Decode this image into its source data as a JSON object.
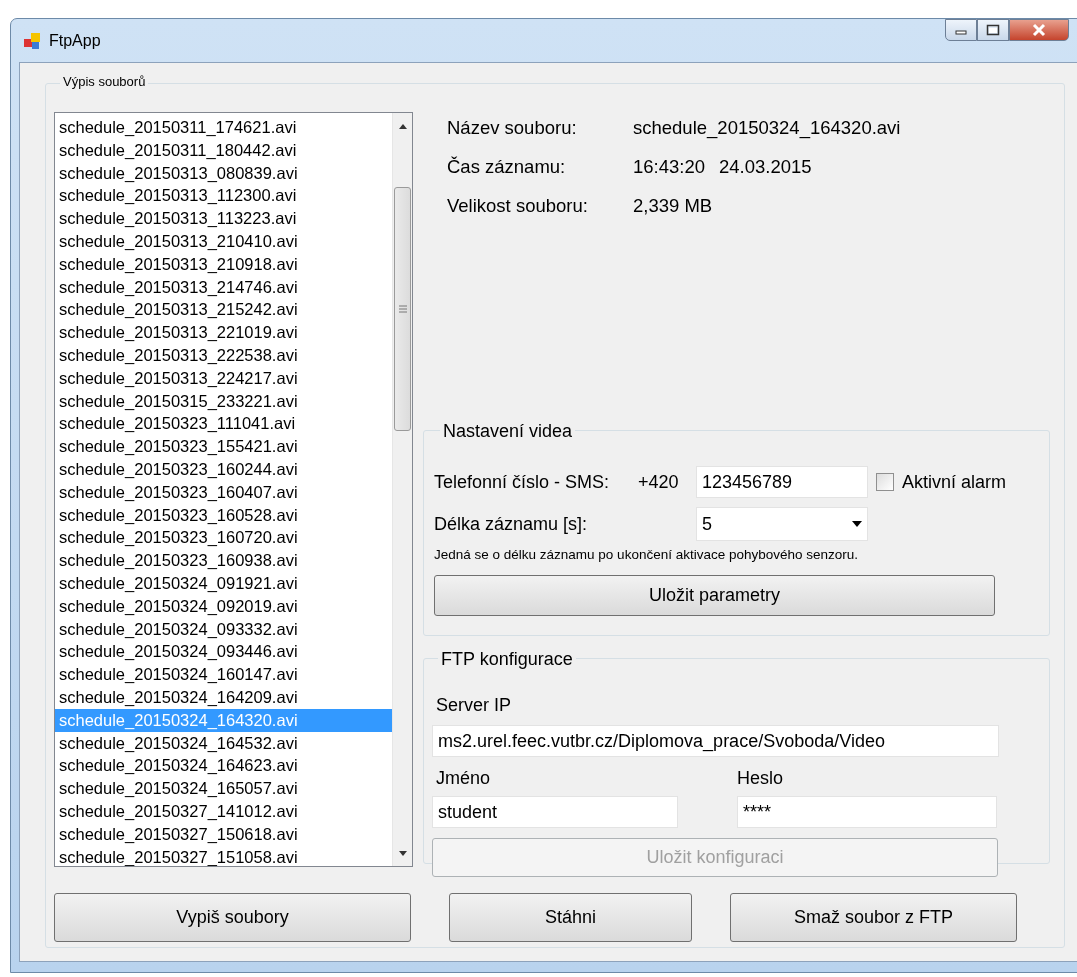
{
  "window": {
    "title": "FtpApp"
  },
  "file_list": {
    "title": "Výpis souborů",
    "items": [
      {
        "label": "schedule_20150311_174621.avi",
        "selected": false
      },
      {
        "label": "schedule_20150311_180442.avi",
        "selected": false
      },
      {
        "label": "schedule_20150313_080839.avi",
        "selected": false
      },
      {
        "label": "schedule_20150313_112300.avi",
        "selected": false
      },
      {
        "label": "schedule_20150313_113223.avi",
        "selected": false
      },
      {
        "label": "schedule_20150313_210410.avi",
        "selected": false
      },
      {
        "label": "schedule_20150313_210918.avi",
        "selected": false
      },
      {
        "label": "schedule_20150313_214746.avi",
        "selected": false
      },
      {
        "label": "schedule_20150313_215242.avi",
        "selected": false
      },
      {
        "label": "schedule_20150313_221019.avi",
        "selected": false
      },
      {
        "label": "schedule_20150313_222538.avi",
        "selected": false
      },
      {
        "label": "schedule_20150313_224217.avi",
        "selected": false
      },
      {
        "label": "schedule_20150315_233221.avi",
        "selected": false
      },
      {
        "label": "schedule_20150323_111041.avi",
        "selected": false
      },
      {
        "label": "schedule_20150323_155421.avi",
        "selected": false
      },
      {
        "label": "schedule_20150323_160244.avi",
        "selected": false
      },
      {
        "label": "schedule_20150323_160407.avi",
        "selected": false
      },
      {
        "label": "schedule_20150323_160528.avi",
        "selected": false
      },
      {
        "label": "schedule_20150323_160720.avi",
        "selected": false
      },
      {
        "label": "schedule_20150323_160938.avi",
        "selected": false
      },
      {
        "label": "schedule_20150324_091921.avi",
        "selected": false
      },
      {
        "label": "schedule_20150324_092019.avi",
        "selected": false
      },
      {
        "label": "schedule_20150324_093332.avi",
        "selected": false
      },
      {
        "label": "schedule_20150324_093446.avi",
        "selected": false
      },
      {
        "label": "schedule_20150324_160147.avi",
        "selected": false
      },
      {
        "label": "schedule_20150324_164209.avi",
        "selected": false
      },
      {
        "label": "schedule_20150324_164320.avi",
        "selected": true
      },
      {
        "label": "schedule_20150324_164532.avi",
        "selected": false
      },
      {
        "label": "schedule_20150324_164623.avi",
        "selected": false
      },
      {
        "label": "schedule_20150324_165057.avi",
        "selected": false
      },
      {
        "label": "schedule_20150327_141012.avi",
        "selected": false
      },
      {
        "label": "schedule_20150327_150618.avi",
        "selected": false
      },
      {
        "label": "schedule_20150327_151058.avi",
        "selected": false
      }
    ]
  },
  "file_info": [
    {
      "label": "Název souboru:",
      "values": [
        "schedule_20150324_164320.avi"
      ]
    },
    {
      "label": "Čas záznamu:",
      "values": [
        "16:43:20",
        "24.03.2015"
      ]
    },
    {
      "label": "Velikost souboru:",
      "values": [
        "2,339 MB"
      ]
    }
  ],
  "video_settings": {
    "title": "Nastavení videa",
    "phone_label": "Telefonní číslo - SMS:",
    "phone_prefix": "+420",
    "phone_value": "123456789",
    "alarm": {
      "label": "Aktivní alarm",
      "checked": false
    },
    "duration_label": "Délka záznamu [s]:",
    "duration_value": "5",
    "note": "Jedná se o délku záznamu po ukončení aktivace pohybového senzoru.",
    "save_button": {
      "label": "Uložit parametry",
      "disabled": false
    }
  },
  "ftp_config": {
    "title": "FTP konfigurace",
    "server_label": "Server IP",
    "server_value": "ms2.urel.feec.vutbr.cz/Diplomova_prace/Svoboda/Video",
    "name_label": "Jméno",
    "name_value": "student",
    "password_label": "Heslo",
    "password_value": "****",
    "save_button": {
      "label": "Uložit konfiguraci",
      "disabled": true
    }
  },
  "buttons": [
    {
      "label": "Vypiš soubory",
      "disabled": false
    },
    {
      "label": "Stáhni",
      "disabled": false
    },
    {
      "label": "Smaž soubor z FTP",
      "disabled": false
    }
  ]
}
